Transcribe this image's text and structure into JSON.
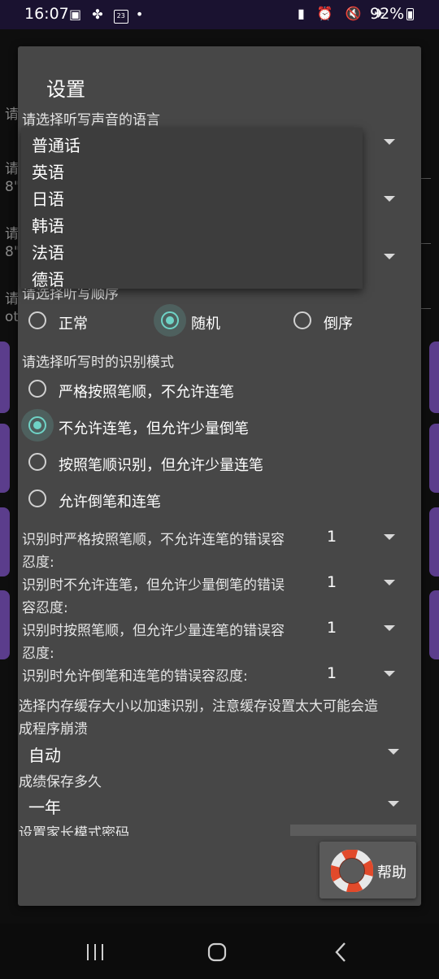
{
  "status_bar": {
    "time": "16:07",
    "left_icons": [
      "notification-card-icon",
      "pinwheel-icon",
      "calendar-23-icon",
      "dot-icon"
    ],
    "calendar_day": "23",
    "battery": "92%"
  },
  "background": {
    "left_fragments": [
      "请",
      "请",
      "8\"",
      "请",
      "8\"",
      "请",
      "ot"
    ]
  },
  "dialog": {
    "title": "设置",
    "voice_language_label": "请选择听写声音的语言",
    "language_options": [
      "普通话",
      "英语",
      "日语",
      "韩语",
      "法语",
      "德语"
    ],
    "order_label": "请选择听写顺序",
    "order_options": [
      {
        "label": "正常",
        "selected": false
      },
      {
        "label": "随机",
        "selected": true
      },
      {
        "label": "倒序",
        "selected": false
      }
    ],
    "mode_label": "请选择听写时的识别模式",
    "mode_options": [
      {
        "label": "严格按照笔顺，不允许连笔",
        "selected": false
      },
      {
        "label": "不允许连笔，但允许少量倒笔",
        "selected": true
      },
      {
        "label": "按照笔顺识别，但允许少量连笔",
        "selected": false
      },
      {
        "label": "允许倒笔和连笔",
        "selected": false
      }
    ],
    "tolerances": [
      {
        "label_line1": "识别时严格按照笔顺，不允许连笔的错误容",
        "label_line2": "忍度:",
        "value": "1"
      },
      {
        "label_line1": "识别时不允许连笔，但允许少量倒笔的错误",
        "label_line2": "容忍度:",
        "value": "1"
      },
      {
        "label_line1": "识别时按照笔顺，但允许少量连笔的错误容",
        "label_line2": "忍度:",
        "value": "1"
      },
      {
        "label_line1": "识别时允许倒笔和连笔的错误容忍度:",
        "label_line2": "",
        "value": "1"
      }
    ],
    "cache_label_line1": "选择内存缓存大小以加速识别，注意缓存设置太大可能会造",
    "cache_label_line2": "成程序崩溃",
    "cache_value": "自动",
    "score_label": "成绩保存多久",
    "score_value": "一年",
    "parent_password_label": "设置家长模式密码",
    "help_button": "帮助"
  },
  "colors": {
    "accent": "#6fd3c6",
    "dialog_bg": "#474747",
    "background_purple": "#5b3d8c"
  }
}
